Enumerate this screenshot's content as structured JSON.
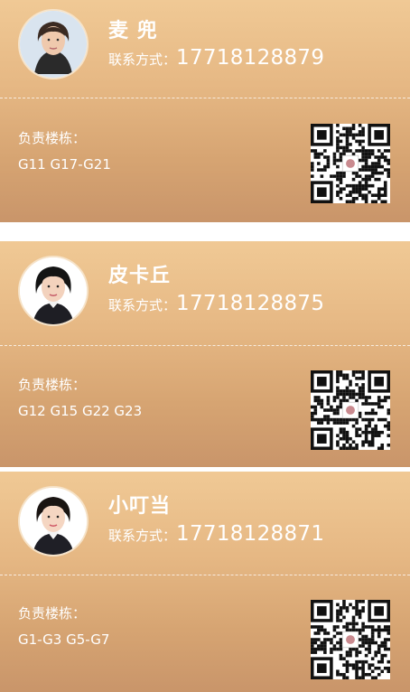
{
  "contact_label": "联系方式：",
  "building_label": "负责楼栋：",
  "cards": [
    {
      "name": "麦 兜",
      "phone": "17718128879",
      "buildings": "G11 G17-G21"
    },
    {
      "name": "皮卡丘",
      "phone": "17718128875",
      "buildings": "G12 G15 G22 G23"
    },
    {
      "name": "小叮当",
      "phone": "17718128871",
      "buildings": "G1-G3 G5-G7"
    }
  ],
  "colors": {
    "card_gradient_top": "#f0c995",
    "card_gradient_bottom": "#c9956a",
    "text": "#ffffff"
  },
  "icons": {
    "avatar": "person-photo",
    "qr": "qr-code"
  }
}
